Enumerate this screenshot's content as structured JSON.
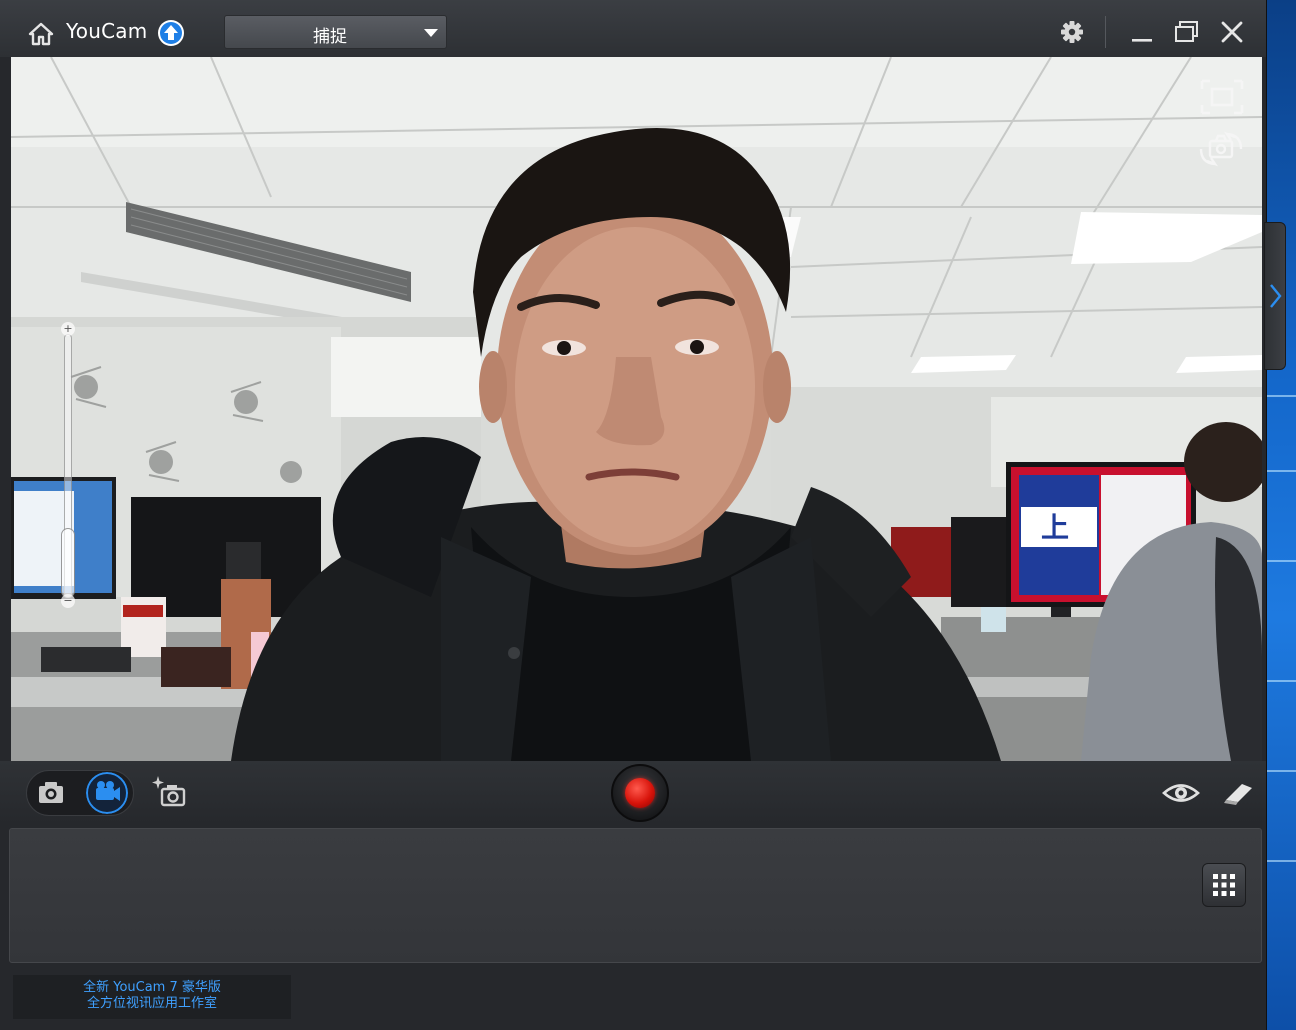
{
  "app": {
    "name": "YouCam",
    "mode": "捕捉"
  },
  "promo": {
    "line1": "全新  YouCam 7 豪华版",
    "line2": "全方位视讯应用工作室"
  },
  "icons": {
    "home": "home-icon",
    "upgrade": "upgrade-icon",
    "settings": "gear-icon",
    "minimize": "minimize-icon",
    "maximize": "maximize-icon",
    "close": "close-icon",
    "photo_mode": "camera-icon",
    "video_mode": "video-camera-icon",
    "smart_capture": "sparkle-camera-icon",
    "record": "record-icon",
    "preview": "eye-icon",
    "eraser": "eraser-icon",
    "grid": "grid-icon",
    "fit_screen": "fit-screen-icon",
    "flip_camera": "flip-camera-icon",
    "side_panel": "chevron-right-icon"
  },
  "colors": {
    "accent": "#1e90ff",
    "record": "#d8140b",
    "promo_text": "#3fa0ff"
  },
  "state": {
    "active_capture_mode": "video",
    "zoom_level": 0.0
  }
}
